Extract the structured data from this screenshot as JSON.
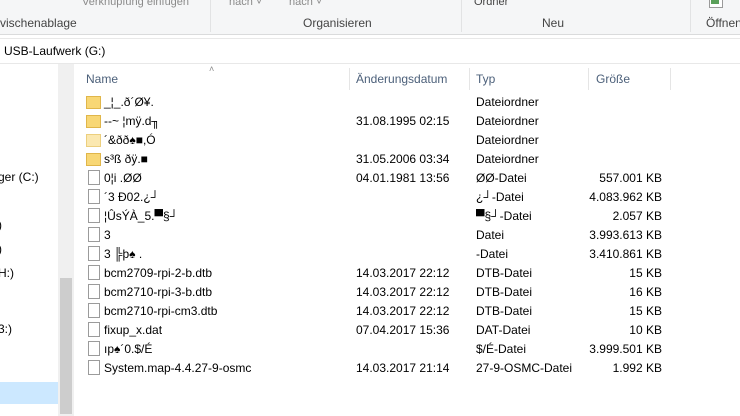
{
  "ribbon": {
    "cut_left": "vischenablage",
    "cut_shortcut": "Verknüpfung einfügen",
    "nach1": "nach ˅",
    "nach2": "nach ˅",
    "organisieren": "Organisieren",
    "ordner": "Ordner",
    "neu": "Neu",
    "oeffnen": "Öffnen"
  },
  "address": {
    "path": "USB-Laufwerk (G:)"
  },
  "nav": {
    "items": [
      "ger (C:)",
      ")",
      ")",
      "H:)",
      "3:)"
    ]
  },
  "columns": {
    "name": "Name",
    "date": "Änderungsdatum",
    "type": "Typ",
    "size": "Größe"
  },
  "files": [
    {
      "icon": "folder",
      "name": "_¦_.ð´Ø¥.",
      "date": "",
      "type": "Dateiordner",
      "size": ""
    },
    {
      "icon": "folder",
      "name": "--~ ¦mÿ.d╖",
      "date": "31.08.1995 02:15",
      "type": "Dateiordner",
      "size": ""
    },
    {
      "icon": "folder-pale",
      "name": "´&ðð♠■,Ó",
      "date": "",
      "type": "Dateiordner",
      "size": ""
    },
    {
      "icon": "folder",
      "name": "s³ß ðÿ.■",
      "date": "31.05.2006 03:34",
      "type": "Dateiordner",
      "size": ""
    },
    {
      "icon": "file",
      "name": "0¦i .ØØ",
      "date": "04.01.1981 13:56",
      "type": "ØØ-Datei",
      "size": "557.001 KB"
    },
    {
      "icon": "file",
      "name": "´3 Ð02.¿┘",
      "date": "",
      "type": "¿┘-Datei",
      "size": "4.083.962 KB"
    },
    {
      "icon": "file",
      "name": "¦ÛsÝÀ_5.▀§┘",
      "date": "",
      "type": "▀§┘-Datei",
      "size": "2.057 KB"
    },
    {
      "icon": "file",
      "name": "3",
      "date": "",
      "type": "Datei",
      "size": "3.993.613 KB"
    },
    {
      "icon": "file",
      "name": "3 ╠þ♠ . ",
      "date": "",
      "type": "-Datei",
      "size": "3.410.861 KB"
    },
    {
      "icon": "file",
      "name": "bcm2709-rpi-2-b.dtb",
      "date": "14.03.2017 22:12",
      "type": "DTB-Datei",
      "size": "15 KB"
    },
    {
      "icon": "file",
      "name": "bcm2710-rpi-3-b.dtb",
      "date": "14.03.2017 22:12",
      "type": "DTB-Datei",
      "size": "16 KB"
    },
    {
      "icon": "file",
      "name": "bcm2710-rpi-cm3.dtb",
      "date": "14.03.2017 22:12",
      "type": "DTB-Datei",
      "size": "15 KB"
    },
    {
      "icon": "file",
      "name": "fixup_x.dat",
      "date": "07.04.2017 15:36",
      "type": "DAT-Datei",
      "size": "10 KB"
    },
    {
      "icon": "file",
      "name": "ıp♠´0.$/É",
      "date": "",
      "type": "$/É-Datei",
      "size": "3.999.501 KB"
    },
    {
      "icon": "file",
      "name": "System.map-4.4.27-9-osmc",
      "date": "14.03.2017 21:14",
      "type": "27-9-OSMC-Datei",
      "size": "1.992 KB"
    }
  ]
}
